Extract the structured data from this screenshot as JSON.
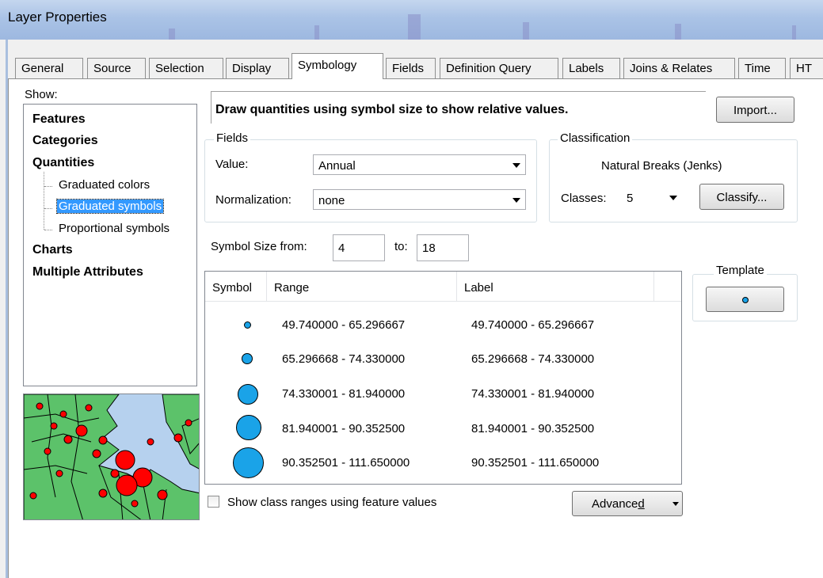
{
  "window": {
    "title": "Layer Properties"
  },
  "tabs": [
    "General",
    "Source",
    "Selection",
    "Display",
    "Symbology",
    "Fields",
    "Definition Query",
    "Labels",
    "Joins & Relates",
    "Time",
    "HT"
  ],
  "active_tab": "Symbology",
  "show": {
    "label": "Show:",
    "features": "Features",
    "categories": "Categories",
    "quantities": "Quantities",
    "graduated_colors": "Graduated colors",
    "graduated_symbols": "Graduated symbols",
    "proportional_symbols": "Proportional symbols",
    "charts": "Charts",
    "multiple_attributes": "Multiple Attributes"
  },
  "description": "Draw quantities using symbol size to show relative values.",
  "import_label": "Import...",
  "fields": {
    "group_label": "Fields",
    "value_label": "Value:",
    "value": "Annual",
    "normalization_label": "Normalization:",
    "normalization": "none"
  },
  "classification": {
    "group_label": "Classification",
    "method": "Natural Breaks (Jenks)",
    "classes_label": "Classes:",
    "classes": "5",
    "classify_label": "Classify..."
  },
  "symbol_size": {
    "from_label": "Symbol Size from:",
    "from": "4",
    "to_label": "to:",
    "to": "18"
  },
  "template": {
    "label": "Template"
  },
  "table": {
    "headers": [
      "Symbol",
      "Range",
      "Label"
    ],
    "rows": [
      {
        "range": "49.740000 - 65.296667",
        "label": "49.740000 - 65.296667"
      },
      {
        "range": "65.296668 - 74.330000",
        "label": "65.296668 - 74.330000"
      },
      {
        "range": "74.330001 - 81.940000",
        "label": "74.330001 - 81.940000"
      },
      {
        "range": "81.940001 - 90.352500",
        "label": "81.940001 - 90.352500"
      },
      {
        "range": "90.352501 - 111.650000",
        "label": "90.352501 - 111.650000"
      }
    ]
  },
  "show_class_ranges": "Show class ranges using feature values",
  "advanced_prefix": "Advance",
  "advanced_mnemonic": "d",
  "colors": {
    "symbol_fill": "#1aa3e8",
    "selection": "#3399ff",
    "preview_point": "#ff0000",
    "preview_land": "#5cc26a",
    "preview_water": "#b6d1ee"
  }
}
